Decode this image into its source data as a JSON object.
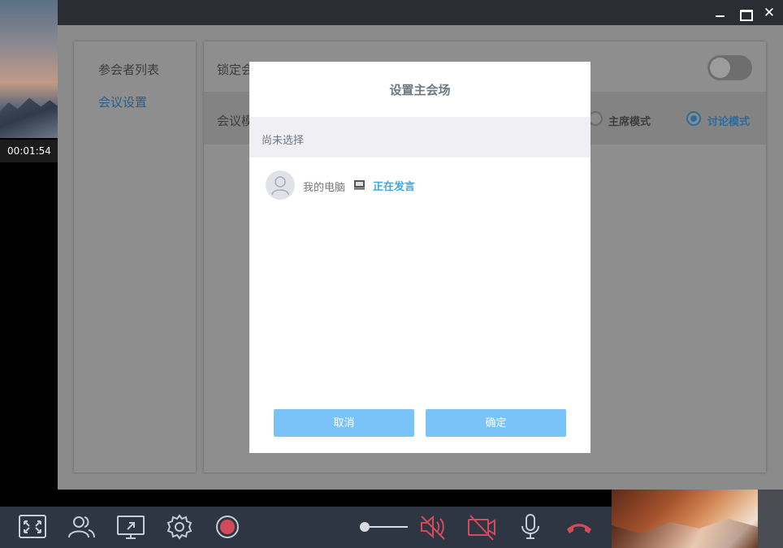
{
  "call": {
    "timer": "00:01:54"
  },
  "sidebar": {
    "items": [
      {
        "label": "参会者列表"
      },
      {
        "label": "会议设置"
      }
    ]
  },
  "settings": {
    "lock_label": "锁定会",
    "mode_label": "会议模",
    "mode_options": [
      {
        "label": "主席模式",
        "selected": false
      },
      {
        "label": "讨论模式",
        "selected": true
      }
    ]
  },
  "dialog": {
    "title": "设置主会场",
    "selected_text": "尚未选择",
    "participant": {
      "name": "我的电脑",
      "device_icon": "computer-icon",
      "status": "正在发言"
    },
    "cancel_label": "取消",
    "confirm_label": "确定"
  },
  "toolbar": {
    "icons": [
      "fullscreen-icon",
      "participants-icon",
      "screen-share-icon",
      "settings-gear-icon",
      "record-icon",
      "volume-slider",
      "speaker-muted-icon",
      "camera-off-icon",
      "microphone-icon",
      "hang-up-icon"
    ]
  },
  "colors": {
    "accent": "#3ba7ef",
    "button": "#79c3f9",
    "toolbar_bg": "#2d3642",
    "danger": "#d14b5a"
  }
}
